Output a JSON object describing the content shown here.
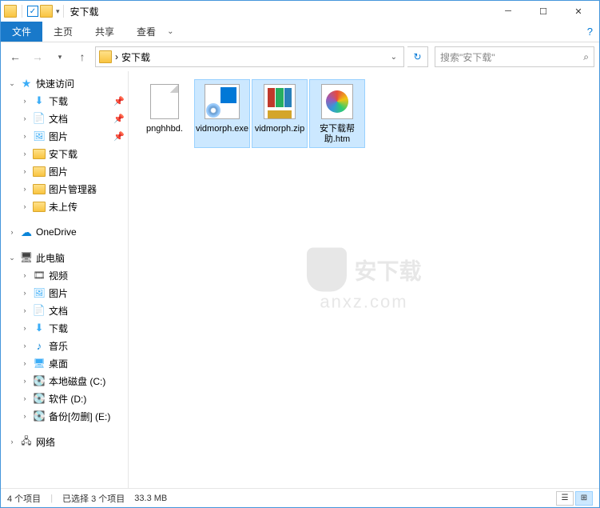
{
  "window": {
    "title": "安下载"
  },
  "quick_access_checked": "✓",
  "ribbon": {
    "file": "文件",
    "tabs": [
      "主页",
      "共享",
      "查看"
    ]
  },
  "nav": {
    "separator": "›",
    "path": "安下载",
    "search_placeholder": "搜索\"安下载\""
  },
  "sidebar": {
    "quick_access": "快速访问",
    "items_qa": [
      {
        "label": "下载",
        "icon": "download",
        "pinned": true
      },
      {
        "label": "文档",
        "icon": "doc",
        "pinned": true
      },
      {
        "label": "图片",
        "icon": "pic",
        "pinned": true
      },
      {
        "label": "安下载",
        "icon": "folder",
        "pinned": false
      },
      {
        "label": "图片",
        "icon": "folder",
        "pinned": false
      },
      {
        "label": "图片管理器",
        "icon": "folder",
        "pinned": false
      },
      {
        "label": "未上传",
        "icon": "folder",
        "pinned": false
      }
    ],
    "onedrive": "OneDrive",
    "thispc": "此电脑",
    "items_pc": [
      {
        "label": "视频",
        "icon": "video"
      },
      {
        "label": "图片",
        "icon": "pic"
      },
      {
        "label": "文档",
        "icon": "doc"
      },
      {
        "label": "下载",
        "icon": "download"
      },
      {
        "label": "音乐",
        "icon": "music"
      },
      {
        "label": "桌面",
        "icon": "desktop"
      },
      {
        "label": "本地磁盘 (C:)",
        "icon": "drive"
      },
      {
        "label": "软件 (D:)",
        "icon": "drive"
      },
      {
        "label": "备份[勿删] (E:)",
        "icon": "drive"
      }
    ],
    "network": "网络"
  },
  "files": [
    {
      "name": "pnghhbd.",
      "selected": false,
      "type": "page"
    },
    {
      "name": "vidmorph.exe",
      "selected": true,
      "type": "exe"
    },
    {
      "name": "vidmorph.zip",
      "selected": true,
      "type": "zip"
    },
    {
      "name": "安下载帮助.htm",
      "selected": true,
      "type": "htm"
    }
  ],
  "watermark": {
    "line1": "安下载",
    "line2": "anxz.com"
  },
  "status": {
    "count": "4 个项目",
    "selection": "已选择 3 个项目",
    "size": "33.3 MB"
  }
}
